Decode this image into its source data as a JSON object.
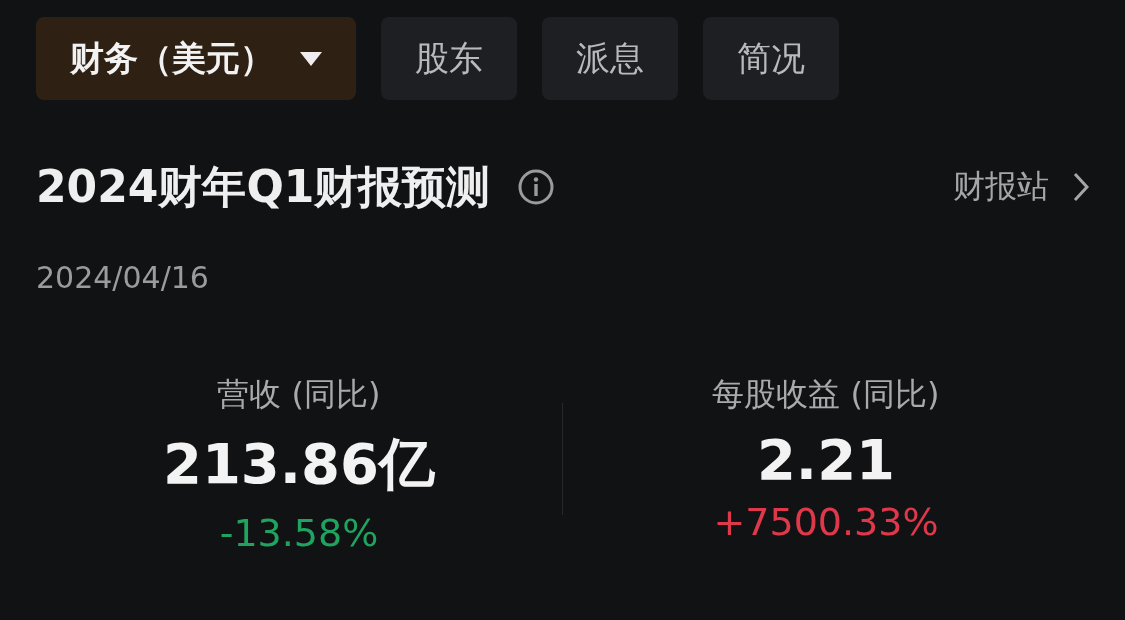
{
  "tabs": [
    {
      "label": "财务（美元）",
      "selected": true,
      "dropdown": true
    },
    {
      "label": "股东",
      "selected": false,
      "dropdown": false
    },
    {
      "label": "派息",
      "selected": false,
      "dropdown": false
    },
    {
      "label": "简况",
      "selected": false,
      "dropdown": false
    }
  ],
  "header": {
    "title": "2024财年Q1财报预测",
    "link": "财报站"
  },
  "date": "2024/04/16",
  "metrics": [
    {
      "label": "营收 (同比)",
      "value": "213.86亿",
      "change": "-13.58%",
      "color": "#1fa35f"
    },
    {
      "label": "每股收益 (同比)",
      "value": "2.21",
      "change": "+7500.33%",
      "color": "#e0384b"
    }
  ]
}
